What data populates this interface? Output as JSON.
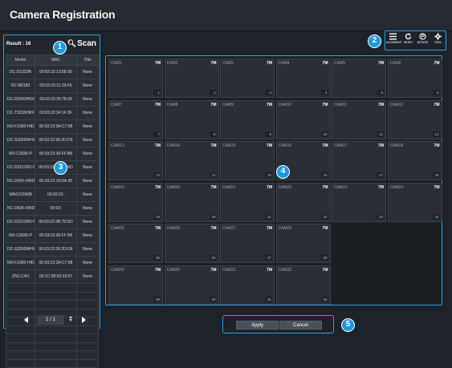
{
  "window": {
    "title": "Camera Registration"
  },
  "scan_panel": {
    "result_text": "Result : 16",
    "scan_label": "Scan",
    "columns": [
      "Model",
      "MAC",
      "Title"
    ],
    "rows": [
      {
        "model": "DC-D1323R",
        "mac": "00:03:22:13:5E:90",
        "title": "None"
      },
      {
        "model": "DC-B0183",
        "mac": "00:03:22:11:29:F6",
        "title": "None"
      },
      {
        "model": "DC-D3343HRX",
        "mac": "00:03:22:30:78:29",
        "title": "None"
      },
      {
        "model": "DC-T3233HRXL",
        "mac": "00:03:22:34:1F:3F",
        "title": "None"
      },
      {
        "model": "NO-F3350-HIDP",
        "mac": "00:03:22:3A:C7:98",
        "title": "None"
      },
      {
        "model": "DC-S3350WHX",
        "mac": "00:03:22:36:2D:D6",
        "title": "None"
      },
      {
        "model": "NO-C9330-P",
        "mac": "00:03:22:36:FF:B8",
        "title": "None"
      },
      {
        "model": "DC-D3212RX-N",
        "mac": "00:03:22:3B:7D:6D",
        "title": "None"
      },
      {
        "model": "NC-D426-XWD",
        "mac": "00:03:22:1A:5A:95",
        "title": "None"
      },
      {
        "model": "WNO220WB",
        "mac": "00:03:22:",
        "title": "None"
      },
      {
        "model": "NC-D426-XWD",
        "mac": "00:03:",
        "title": "None"
      },
      {
        "model": "DC-D3212RX-N",
        "mac": "00:03:22:3B:7D:5D",
        "title": "None"
      },
      {
        "model": "NO-C9330-P",
        "mac": "00:03:22:36:FF:B8",
        "title": "None"
      },
      {
        "model": "DC-S3350WHX",
        "mac": "00:03:22:36:2D:D6",
        "title": "None"
      },
      {
        "model": "NO-F3350-HIDP",
        "mac": "00:03:22:3A:C7:98",
        "title": "None"
      },
      {
        "model": "ZN1-C4U",
        "mac": "00:1C:08:03:33:97",
        "title": "None"
      }
    ],
    "pager": {
      "page_text": "1 / 1"
    }
  },
  "toolbar": {
    "alignment_label": "ALIGNMENT",
    "reset_label": "RESET",
    "bitrate_label": "BITRATE",
    "tool_label": "TOOL"
  },
  "camera_grid": {
    "resolution": "7M",
    "rows": [
      [
        {
          "name": "CAM1",
          "num": "1"
        },
        {
          "name": "CAM2",
          "num": "2"
        },
        {
          "name": "CAM3",
          "num": "3"
        },
        {
          "name": "CAM4",
          "num": "4"
        },
        {
          "name": "CAM5",
          "num": "5"
        },
        {
          "name": "CAM6",
          "num": "6"
        }
      ],
      [
        {
          "name": "CAM7",
          "num": "7"
        },
        {
          "name": "CAM8",
          "num": "8"
        },
        {
          "name": "CAM9",
          "num": "9"
        },
        {
          "name": "CAM10",
          "num": "10"
        },
        {
          "name": "CAM11",
          "num": "11"
        },
        {
          "name": "CAM12",
          "num": "12"
        }
      ],
      [
        {
          "name": "CAM13",
          "num": "13"
        },
        {
          "name": "CAM14",
          "num": "14"
        },
        {
          "name": "CAM15",
          "num": "15"
        },
        {
          "name": "CAM16",
          "num": "16"
        },
        {
          "name": "CAM17",
          "num": "17"
        },
        {
          "name": "CAM18",
          "num": "18"
        }
      ],
      [
        {
          "name": "CAM19",
          "num": "19"
        },
        {
          "name": "CAM20",
          "num": "20"
        },
        {
          "name": "CAM21",
          "num": "21"
        },
        {
          "name": "CAM22",
          "num": "22"
        },
        {
          "name": "CAM23",
          "num": "23"
        },
        {
          "name": "CAM24",
          "num": "24"
        }
      ],
      [
        {
          "name": "CAM25",
          "num": "25"
        },
        {
          "name": "CAM26",
          "num": "26"
        },
        {
          "name": "CAM27",
          "num": "27"
        },
        {
          "name": "CAM28",
          "num": "28"
        }
      ],
      [
        {
          "name": "CAM29",
          "num": "29"
        },
        {
          "name": "CAM30",
          "num": "30"
        },
        {
          "name": "CAM31",
          "num": "31"
        },
        {
          "name": "CAM32",
          "num": "32"
        }
      ]
    ]
  },
  "footer": {
    "apply_label": "Apply",
    "cancel_label": "Cancel"
  },
  "callouts": [
    "1",
    "2",
    "3",
    "4",
    "5"
  ],
  "colors": {
    "accent": "#2a9fd8",
    "badge": "#1b9be0",
    "background": "#1e2329"
  }
}
